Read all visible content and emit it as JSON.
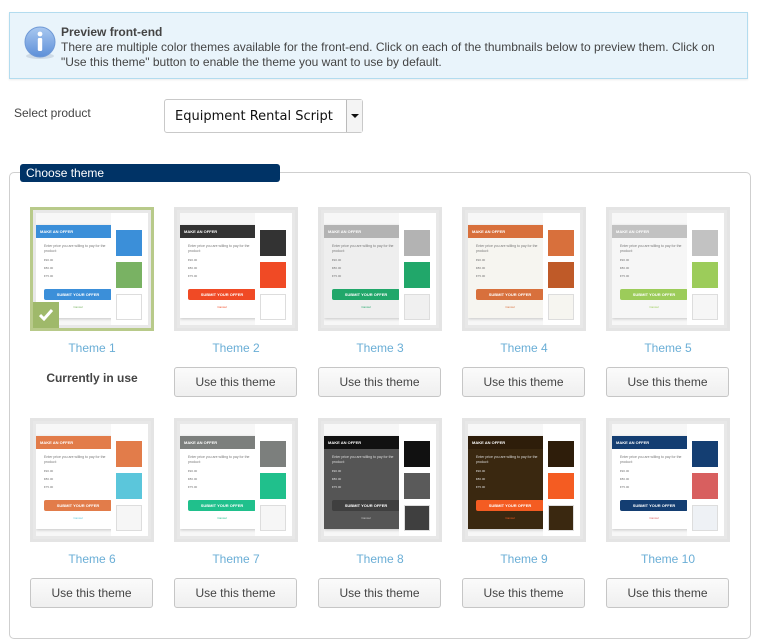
{
  "notice": {
    "icon": "info-icon",
    "title": "Preview front-end",
    "text": "There are multiple color themes available for the front-end. Click on each of the thumbnails below to preview them. Click on \"Use this theme\" button to enable the theme you want to use by default."
  },
  "product": {
    "label": "Select product",
    "selected": "Equipment Rental Script"
  },
  "themes_section": {
    "legend": "Choose theme",
    "current_label": "Currently in use",
    "use_button_label": "Use this theme",
    "preview": {
      "header": "MAKE AN OFFER",
      "text": "Enter price you are willing to pay for the product:",
      "options": [
        "€90.00",
        "€80.00",
        "€75.00"
      ],
      "submit": "SUBMIT YOUR OFFER",
      "cancel": "Cancel"
    },
    "themes": [
      {
        "name": "Theme 1",
        "active": true,
        "colors": [
          "#3b8fd9",
          "#79b263",
          "#ffffff"
        ],
        "bg": "#ffffff",
        "header": "#3b8fd9",
        "button": "#3b8fd9",
        "cancel": "#79b263"
      },
      {
        "name": "Theme 2",
        "active": false,
        "colors": [
          "#333333",
          "#f04a25",
          "#ffffff"
        ],
        "bg": "#ffffff",
        "header": "#333333",
        "button": "#f04a25",
        "cancel": "#f04a25"
      },
      {
        "name": "Theme 3",
        "active": false,
        "colors": [
          "#b3b3b3",
          "#21a76a",
          "#f0f0f0"
        ],
        "bg": "#eeeeee",
        "header": "#b3b3b3",
        "button": "#21a76a",
        "cancel": "#21a76a"
      },
      {
        "name": "Theme 4",
        "active": false,
        "colors": [
          "#d8703c",
          "#bf5a28",
          "#f6f5f0"
        ],
        "bg": "#f6f5f0",
        "header": "#d8703c",
        "button": "#d8703c",
        "cancel": "#d8703c"
      },
      {
        "name": "Theme 5",
        "active": false,
        "colors": [
          "#c2c2c2",
          "#9ccc5a",
          "#f6f6f6"
        ],
        "bg": "#f6f6f6",
        "header": "#c2c2c2",
        "button": "#9ccc5a",
        "cancel": "#9ccc5a"
      },
      {
        "name": "Theme 6",
        "active": false,
        "colors": [
          "#e27c4a",
          "#5bc6db",
          "#f6f6f6"
        ],
        "bg": "#ffffff",
        "header": "#e27c4a",
        "button": "#e27c4a",
        "cancel": "#5bc6db"
      },
      {
        "name": "Theme 7",
        "active": false,
        "colors": [
          "#7c7f7d",
          "#20c08c",
          "#f6f6f6"
        ],
        "bg": "#ffffff",
        "header": "#7c7f7d",
        "button": "#20c08c",
        "cancel": "#20c08c"
      },
      {
        "name": "Theme 8",
        "active": false,
        "colors": [
          "#111111",
          "#5a5a5a",
          "#3f3f3f"
        ],
        "bg": "#555555",
        "header": "#111111",
        "button": "#3f3f3f",
        "cancel": "#cccccc"
      },
      {
        "name": "Theme 9",
        "active": false,
        "colors": [
          "#2e1d0a",
          "#f45c22",
          "#3a2810"
        ],
        "bg": "#3a2810",
        "header": "#2e1d0a",
        "button": "#f45c22",
        "cancel": "#f45c22"
      },
      {
        "name": "Theme 10",
        "active": false,
        "colors": [
          "#143e72",
          "#d85f5f",
          "#eef1f5"
        ],
        "bg": "#ffffff",
        "header": "#143e72",
        "button": "#143e72",
        "cancel": "#d85f5f"
      }
    ]
  }
}
